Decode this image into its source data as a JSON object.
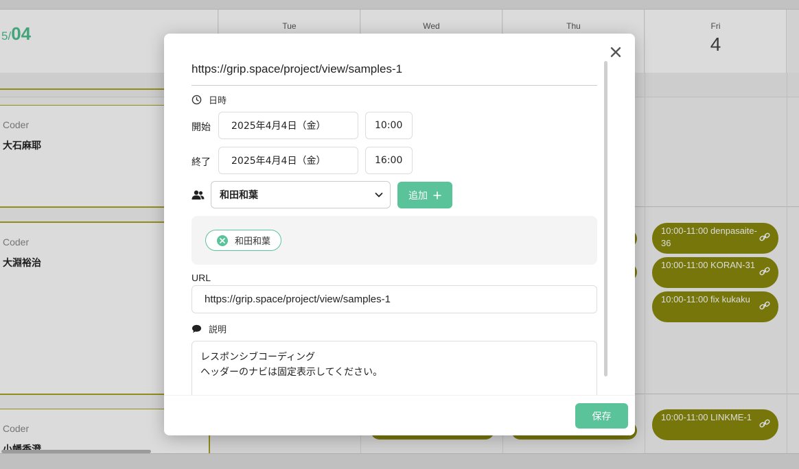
{
  "calendar": {
    "month_prefix": "5/",
    "month_value": "04",
    "days": [
      {
        "name": "Tue",
        "date": ""
      },
      {
        "name": "Wed",
        "date": ""
      },
      {
        "name": "Thu",
        "date": ""
      },
      {
        "name": "Fri",
        "date": "4"
      }
    ],
    "rows": [
      {
        "role": "Coder",
        "person": "大石麻耶"
      },
      {
        "role": "Coder",
        "person": "大淵裕治"
      },
      {
        "role": "Coder",
        "person": "小幡香澄"
      }
    ],
    "events": [
      {
        "label": "10:00-11:00 denpasaite-36"
      },
      {
        "label": "10:00-11:00 KORAN-31"
      },
      {
        "label": "10:00-11:00 fix kukaku"
      },
      {
        "label": "10:00-11:00 LINKME-1"
      }
    ],
    "event_color": "#8a8a0c"
  },
  "modal": {
    "title": "https://grip.space/project/view/samples-1",
    "datetime_label": "日時",
    "start_label": "開始",
    "start_date": "2025年4月4日（金）",
    "start_time": "10:00",
    "end_label": "終了",
    "end_date": "2025年4月4日（金）",
    "end_time": "16:00",
    "member_select_value": "和田和葉",
    "add_button_label": "追加",
    "members": [
      "和田和葉"
    ],
    "url_label": "URL",
    "url_value": "https://grip.space/project/view/samples-1",
    "description_label": "説明",
    "description_line1": "レスポンシブコーディング",
    "description_line2": "ヘッダーのナビは固定表示してください。",
    "save_button_label": "保存",
    "accent_color": "#5ac39a"
  }
}
